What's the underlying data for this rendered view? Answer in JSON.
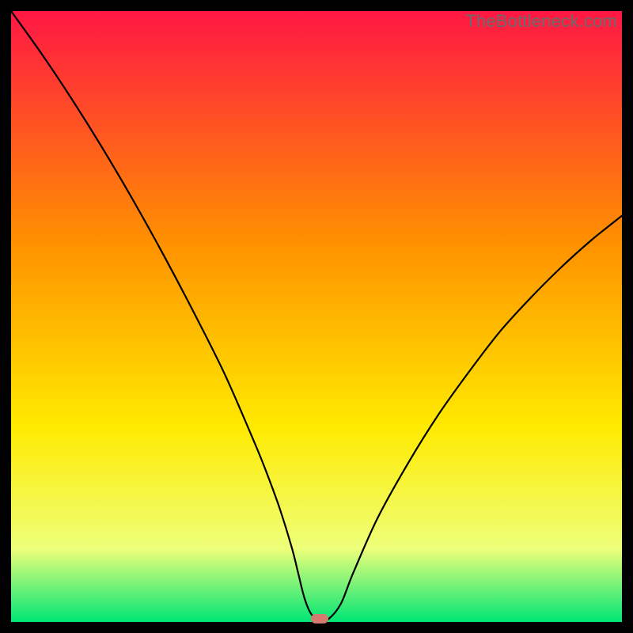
{
  "watermark": "TheBottleneck.com",
  "colors": {
    "gradient_top": "#ff1744",
    "gradient_mid1": "#ff9100",
    "gradient_mid2": "#ffea00",
    "gradient_low": "#eeff7a",
    "gradient_bottom": "#00e676",
    "curve": "#000000",
    "marker": "#d57a6f",
    "frame": "#000000"
  },
  "chart_data": {
    "type": "line",
    "title": "",
    "xlabel": "",
    "ylabel": "",
    "xlim": [
      0,
      100
    ],
    "ylim": [
      0,
      100
    ],
    "series": [
      {
        "name": "bottleneck-curve",
        "x": [
          0,
          5,
          10,
          15,
          20,
          25,
          30,
          35,
          40,
          42,
          44,
          46,
          47,
          48,
          49,
          50,
          51,
          52,
          54,
          56,
          60,
          65,
          70,
          75,
          80,
          85,
          90,
          95,
          100
        ],
        "y": [
          100,
          93,
          85.5,
          77.5,
          69,
          60,
          50.5,
          40.5,
          29,
          24,
          18.5,
          12,
          8,
          4,
          1.5,
          0.5,
          0.5,
          0.5,
          3,
          8,
          17,
          26,
          34,
          41,
          47.5,
          53,
          58,
          62.5,
          66.5
        ]
      }
    ],
    "marker": {
      "x": 50.5,
      "y": 0.5
    },
    "gradient_stops": [
      {
        "pos": 0.0,
        "color": "#ff1744"
      },
      {
        "pos": 0.38,
        "color": "#ff9100"
      },
      {
        "pos": 0.68,
        "color": "#ffea00"
      },
      {
        "pos": 0.88,
        "color": "#eeff7a"
      },
      {
        "pos": 1.0,
        "color": "#00e676"
      }
    ]
  }
}
